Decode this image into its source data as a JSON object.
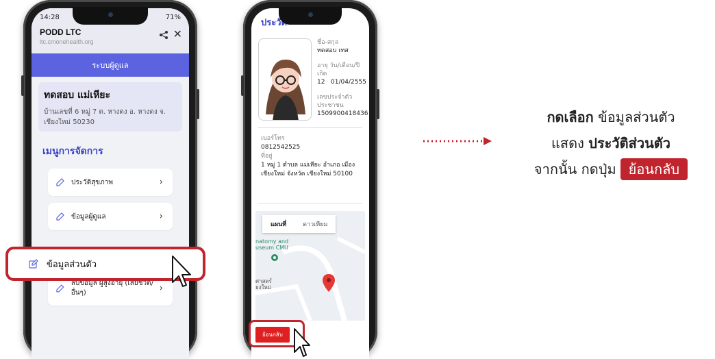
{
  "phone1": {
    "status_time": "14:28",
    "status_right": "71%",
    "app_title": "PODD LTC",
    "app_url": "ltc.cmonehealth.org",
    "blue_bar_label": "ระบบผู้ดูแล",
    "person_name": "ทดสอบ แม่เหียะ",
    "person_address": "บ้านเลขที่ 6 หมู่ 7 ต. หางดง อ. หางดง จ. เชียงใหม่ 50230",
    "menu_title": "เมนูการจัดการ",
    "menu_items": [
      {
        "label": "ประวัติสุขภาพ"
      },
      {
        "label": "ข้อมูลผู้ดูแล"
      },
      {
        "label": "ข้อมูลส่วนตัว"
      },
      {
        "label": "ลบข้อมูล ผู้สูงอายุ (เสียชีวิต/อื่นๆ)"
      }
    ]
  },
  "phone2": {
    "title": "ประวัติ",
    "name_label": "ชื่อ-สกุล",
    "name_value": "ทดสอบ เทส",
    "age_label": "อายุ วัน/เดือน/ปีเกิด",
    "age_value": "12",
    "dob_value": "01/04/2555",
    "id_label": "เลขประจำตัวประชาชน",
    "id_value": "1509900418436",
    "phone_label": "เบอร์โทร",
    "phone_value": "0812542525",
    "address_label": "ที่อยู่",
    "address_value": "1 หมู่ 1 ตำบล แม่เหียะ อำเภอ เมือง เชียงใหม่ จังหวัด เชียงใหม่ 50100",
    "map_tab_map": "แผนที่",
    "map_tab_satellite": "ดาวเทียม",
    "map_poi": "natomy and useum CMU",
    "map_poi2": "ศาสตร์ ยงใหม่",
    "back_button": "ย้อนกลับ"
  },
  "annotation": {
    "bold1": "กดเลือก",
    "text1": " ข้อมูลส่วนตัว",
    "text2": "แสดง ",
    "bold2": "ประวัติส่วนตัว",
    "text3": "จากนั้น กดปุ่ม",
    "button_label": "ย้อนกลับ"
  },
  "colors": {
    "accent_blue": "#5b63e0",
    "highlight_red": "#c0242d",
    "back_red": "#e02020",
    "map_pin": "#e53935"
  }
}
